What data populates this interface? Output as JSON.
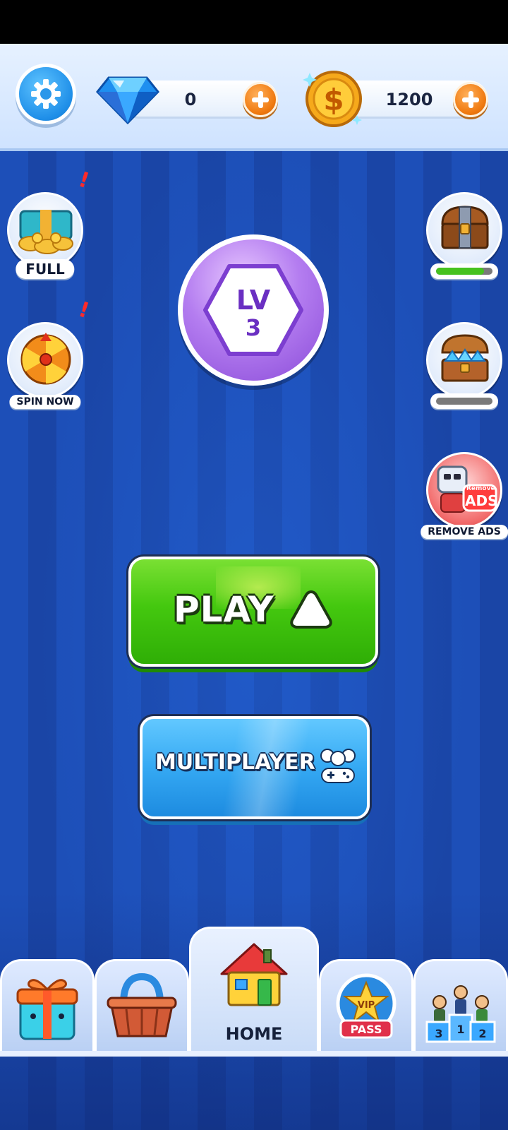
{
  "currency": {
    "gems": "0",
    "coins": "1200"
  },
  "left_widgets": [
    {
      "label": "FULL",
      "alert": "!"
    },
    {
      "label": "SPIN NOW",
      "alert": "!"
    }
  ],
  "right_widgets": {
    "chest_progress": 0.85,
    "gem_chest_progress": 0.0,
    "remove_ads_icon_text": "ADS",
    "remove_ads_icon_subtext": "Remove",
    "remove_ads_label": "REMOVE ADS"
  },
  "level": {
    "prefix": "LV",
    "number": "3"
  },
  "buttons": {
    "play": "PLAY",
    "multiplayer": "MULTIPLAYER"
  },
  "nav": {
    "home": "HOME",
    "pass_badge_top": "VIP",
    "pass_badge_bottom": "PASS",
    "podium_numbers": [
      "3",
      "1",
      "2"
    ]
  },
  "colors": {
    "background": "#1d4fb8",
    "play_green": "#44c80f",
    "multiplayer_blue": "#35a9f3",
    "level_purple": "#b47df0",
    "plus_orange": "#f07a10"
  }
}
